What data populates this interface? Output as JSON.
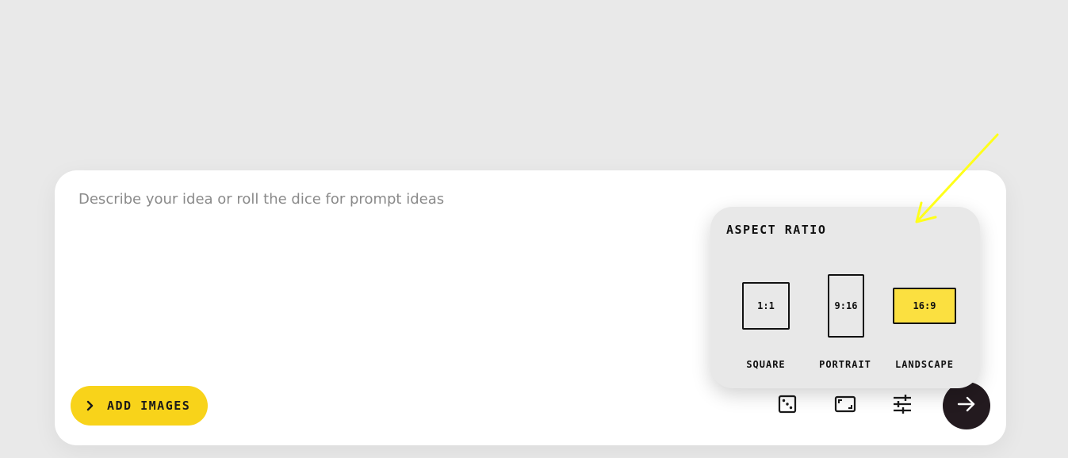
{
  "prompt": {
    "placeholder": "Describe your idea or roll the dice for prompt ideas",
    "value": ""
  },
  "toolbar": {
    "add_images_label": "ADD IMAGES",
    "icons": [
      "dice-icon",
      "aspect-ratio-icon",
      "sliders-icon",
      "arrow-right-icon"
    ]
  },
  "aspect_ratio": {
    "title": "ASPECT RATIO",
    "options": [
      {
        "ratio": "1:1",
        "label": "SQUARE",
        "selected": false
      },
      {
        "ratio": "9:16",
        "label": "PORTRAIT",
        "selected": false
      },
      {
        "ratio": "16:9",
        "label": "LANDSCAPE",
        "selected": true
      }
    ]
  },
  "colors": {
    "background": "#e9e9e9",
    "card": "#ffffff",
    "accent_yellow": "#f8d31a",
    "selected_yellow": "#fbe040",
    "send_button": "#231a1f",
    "annotation_arrow": "#ffff1a"
  }
}
